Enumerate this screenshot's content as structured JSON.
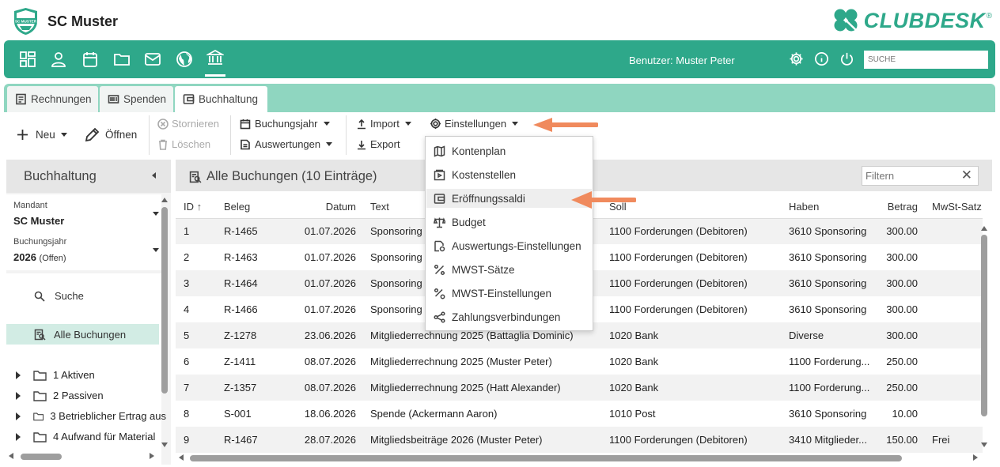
{
  "header": {
    "club_name": "SC Muster",
    "brand": "CLUBDESK",
    "brand_reg": "®",
    "logo_text": "SC MUSTER"
  },
  "nav": {
    "icons": [
      "dashboard-icon",
      "person-icon",
      "calendar-icon",
      "folder-icon",
      "mail-icon",
      "globe-icon",
      "bank-icon"
    ],
    "user_label": "Benutzer: Muster Peter",
    "search_placeholder": "SUCHE"
  },
  "tabs": [
    {
      "label": "Rechnungen",
      "icon": "invoice-icon"
    },
    {
      "label": "Spenden",
      "icon": "barcode-icon"
    },
    {
      "label": "Buchhaltung",
      "icon": "wallet-icon",
      "active": true
    }
  ],
  "toolbar": {
    "neu": "Neu",
    "oeffnen": "Öffnen",
    "stornieren": "Stornieren",
    "loeschen": "Löschen",
    "buchungsjahr": "Buchungsjahr",
    "auswertungen": "Auswertungen",
    "import": "Import",
    "export": "Export",
    "einstellungen": "Einstellungen"
  },
  "menu": [
    {
      "label": "Kontenplan",
      "icon": "map-icon"
    },
    {
      "label": "Kostenstellen",
      "icon": "cost-center-icon"
    },
    {
      "label": "Eröffnungssaldi",
      "icon": "wallet-icon",
      "highlighted": true
    },
    {
      "label": "Budget",
      "icon": "balance-scale-icon"
    },
    {
      "label": "Auswertungs-Einstellungen",
      "icon": "report-settings-icon"
    },
    {
      "label": "MWST-Sätze",
      "icon": "percent-icon"
    },
    {
      "label": "MWST-Einstellungen",
      "icon": "percent-settings-icon"
    },
    {
      "label": "Zahlungsverbindungen",
      "icon": "share-icon"
    }
  ],
  "left": {
    "title": "Buchhaltung",
    "mandant_label": "Mandant",
    "mandant_value": "SC Muster",
    "jahr_label": "Buchungsjahr",
    "jahr_value": "2026",
    "jahr_status": "(Offen)",
    "suche": "Suche",
    "alle": "Alle Buchungen",
    "tree": [
      "1 Aktiven",
      "2 Passiven",
      "3 Betrieblicher Ertrag aus",
      "4 Aufwand für Material"
    ]
  },
  "main": {
    "title": "Alle Buchungen (10 Einträge)",
    "filter_placeholder": "Filtern",
    "columns": [
      "ID",
      "Beleg",
      "Datum",
      "Text",
      "Soll",
      "Haben",
      "Betrag",
      "MwSt-Satz"
    ],
    "rows": [
      [
        "1",
        "R-1465",
        "01.07.2026",
        "Sponsoring",
        "1100 Forderungen (Debitoren)",
        "3610 Sponsoring",
        "300.00",
        ""
      ],
      [
        "2",
        "R-1463",
        "01.07.2026",
        "Sponsoring",
        "1100 Forderungen (Debitoren)",
        "3610 Sponsoring",
        "300.00",
        ""
      ],
      [
        "3",
        "R-1464",
        "01.07.2026",
        "Sponsoring",
        "1100 Forderungen (Debitoren)",
        "3610 Sponsoring",
        "300.00",
        ""
      ],
      [
        "4",
        "R-1466",
        "01.07.2026",
        "Sponsoring",
        "1100 Forderungen (Debitoren)",
        "3610 Sponsoring",
        "300.00",
        ""
      ],
      [
        "5",
        "Z-1278",
        "23.06.2026",
        "Mitgliederrechnung 2025 (Battaglia Dominic)",
        "1020 Bank",
        "Diverse",
        "300.00",
        ""
      ],
      [
        "6",
        "Z-1411",
        "08.07.2026",
        "Mitgliederrechnung 2025 (Muster Peter)",
        "1020 Bank",
        "1100 Forderung...",
        "250.00",
        ""
      ],
      [
        "7",
        "Z-1357",
        "08.07.2026",
        "Mitgliederrechnung 2025 (Hatt Alexander)",
        "1020 Bank",
        "1100 Forderung...",
        "250.00",
        ""
      ],
      [
        "8",
        "S-001",
        "18.06.2026",
        "Spende (Ackermann Aaron)",
        "1010 Post",
        "3610 Sponsoring",
        "10.00",
        ""
      ],
      [
        "9",
        "R-1467",
        "28.07.2026",
        "Mitgliedsbeiträge 2026 (Muster Peter)",
        "1100 Forderungen (Debitoren)",
        "3410 Mitglieder...",
        "150.00",
        "Frei"
      ]
    ]
  },
  "colors": {
    "primary": "#2ea88a",
    "tabbar": "#8fd6c0",
    "arrow": "#f08a5d"
  }
}
